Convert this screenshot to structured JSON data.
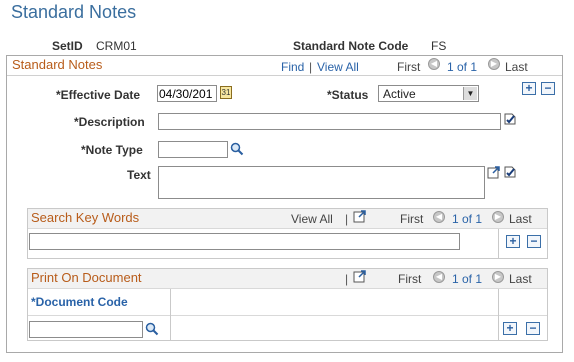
{
  "page": {
    "title": "Standard Notes"
  },
  "header": {
    "setid_label": "SetID",
    "setid_value": "CRM01",
    "code_label": "Standard Note Code",
    "code_value": "FS"
  },
  "standard_notes": {
    "title": "Standard Notes",
    "find": "Find",
    "pipe": "|",
    "view_all": "View All",
    "first": "First",
    "of": "1 of 1",
    "last": "Last",
    "effective_date_label": "*Effective Date",
    "effective_date_value": "04/30/201",
    "status_label": "*Status",
    "status_value": "Active",
    "description_label": "*Description",
    "description_value": "",
    "note_type_label": "*Note Type",
    "note_type_value": "",
    "text_label": "Text",
    "text_value": ""
  },
  "search_key_words": {
    "title": "Search Key Words",
    "view_all": "View All",
    "pipe": "|",
    "first": "First",
    "of": "1 of 1",
    "last": "Last",
    "value": ""
  },
  "print_on_document": {
    "title": "Print On Document",
    "pipe": "|",
    "first": "First",
    "of": "1 of 1",
    "last": "Last",
    "col_document_code": "*Document Code",
    "document_code_value": ""
  },
  "icons": {
    "calendar": "calendar-icon",
    "lookup": "magnifier-icon",
    "spellcheck": "spellcheck-icon",
    "expand": "expand-grid-icon",
    "prev": "arrow-left-circle-icon",
    "next": "arrow-right-circle-icon",
    "add": "plus-icon",
    "delete": "minus-icon"
  },
  "colors": {
    "title": "#3a6e9e",
    "section_title": "#b85c1a",
    "link": "#2a63a8"
  }
}
